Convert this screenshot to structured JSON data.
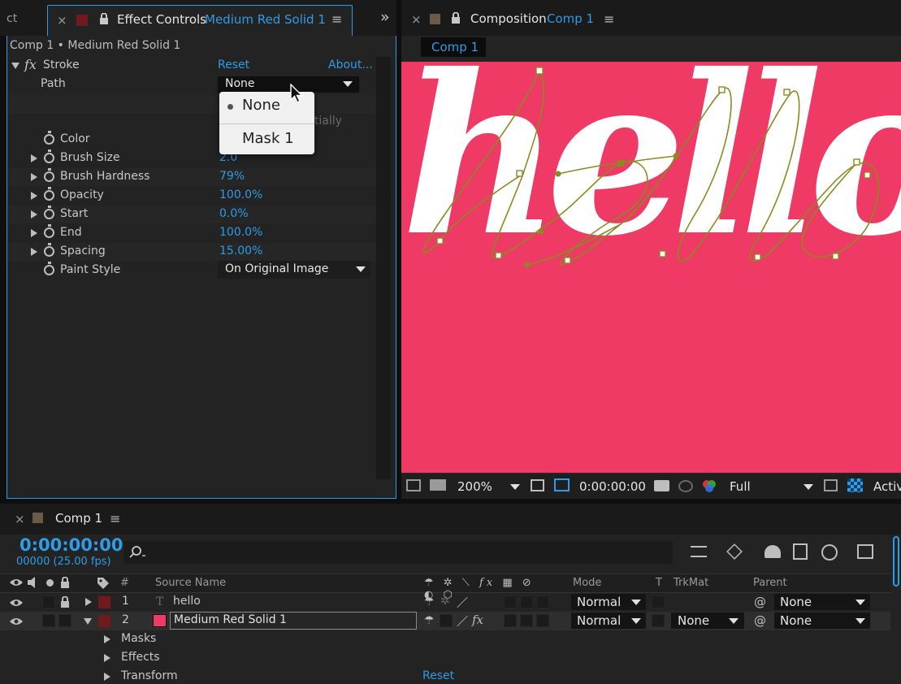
{
  "effect_panel": {
    "left_tab_fragment": "ct",
    "close_x": "×",
    "tab_title": "Effect Controls",
    "tab_layer": "Medium Red Solid 1",
    "menu_glyph": "≡",
    "overflow_glyph": "»",
    "breadcrumb": "Comp 1 • Medium Red Solid 1",
    "effect_name": "Stroke",
    "fx_label": "fx",
    "reset": "Reset",
    "about": "About...",
    "path_label": "Path",
    "path_value": "None",
    "hidden_option_fragment": "ntially",
    "props": [
      {
        "label": "Color",
        "value": "",
        "twirl": false
      },
      {
        "label": "Brush Size",
        "value": "2.0",
        "twirl": true
      },
      {
        "label": "Brush Hardness",
        "value": "79%",
        "twirl": true
      },
      {
        "label": "Opacity",
        "value": "100.0%",
        "twirl": true
      },
      {
        "label": "Start",
        "value": "0.0%",
        "twirl": true
      },
      {
        "label": "End",
        "value": "100.0%",
        "twirl": true
      },
      {
        "label": "Spacing",
        "value": "15.00%",
        "twirl": true
      }
    ],
    "paint_style_label": "Paint Style",
    "paint_style_value": "On Original Image",
    "path_menu": {
      "options": [
        "None",
        "Mask 1"
      ],
      "selected": "None"
    }
  },
  "comp_panel": {
    "close_x": "×",
    "tab_title": "Composition",
    "tab_comp": "Comp 1",
    "menu_glyph": "≡",
    "comp_tab": "Comp 1",
    "canvas_text": "hello",
    "canvas_color": "#ee3a64",
    "zoom": "200%",
    "timecode": "0:00:00:00",
    "resolution": "Full",
    "active_fragment": "Activ"
  },
  "timeline": {
    "close_x": "×",
    "tab_title": "Comp 1",
    "menu_glyph": "≡",
    "timecode": "0:00:00:00",
    "frame_info": "00000 (25.00 fps)",
    "columns": {
      "hash": "#",
      "source_name": "Source Name",
      "mode": "Mode",
      "t": "T",
      "trkmat": "TrkMat",
      "parent": "Parent"
    },
    "layers": [
      {
        "num": "1",
        "name": "hello",
        "mode": "Normal",
        "trkmat": "",
        "parent": "None",
        "color": "#6e1a1f"
      },
      {
        "num": "2",
        "name": "Medium Red Solid 1",
        "mode": "Normal",
        "trkmat": "None",
        "parent": "None",
        "color": "#6e1a1f",
        "swatch": "#ee3a64"
      }
    ],
    "sub_items": [
      "Masks",
      "Effects",
      "Transform"
    ],
    "reset": "Reset"
  },
  "icons": [
    "stopwatch-icon",
    "lock-icon",
    "eye-icon",
    "speaker-icon",
    "solo-icon",
    "label-icon",
    "search-icon",
    "camera-icon",
    "color-channels-icon",
    "parent-pickwhip-icon",
    "shy-icon",
    "fx-icon"
  ],
  "colors": {
    "accent_blue": "#2e9ce6",
    "panel_bg": "#232323",
    "layer_label_red": "#6e1a1f",
    "solid_color": "#ee3a64",
    "path_olive": "#8a8a20"
  }
}
